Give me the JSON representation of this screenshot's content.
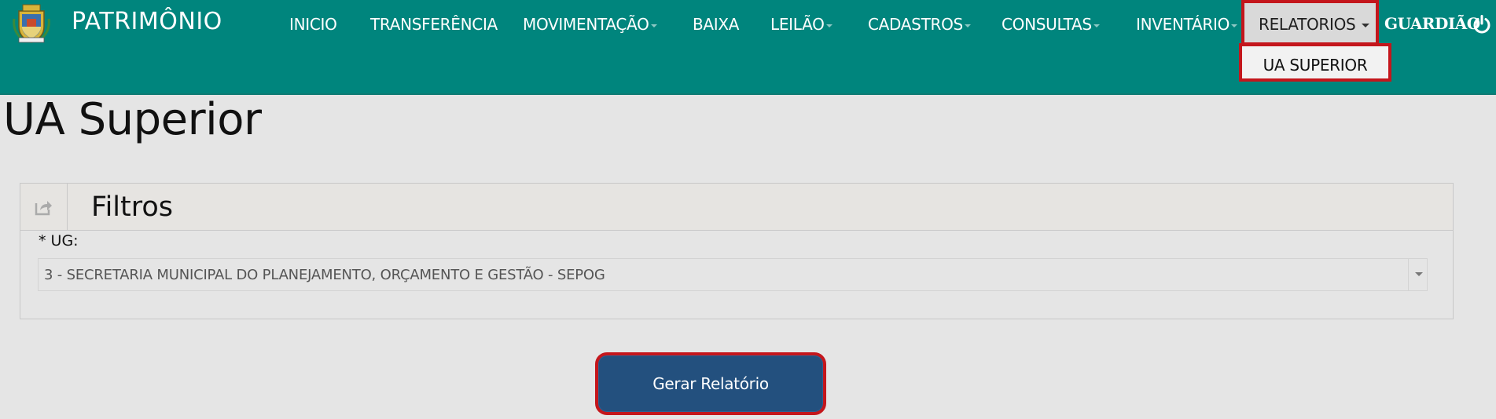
{
  "app": {
    "brand": "PATRIMÔNIO",
    "user": "GUARDIÃO"
  },
  "nav": {
    "items": [
      {
        "label": "INICIO",
        "has_dropdown": false
      },
      {
        "label": "TRANSFERÊNCIA",
        "has_dropdown": false
      },
      {
        "label": "MOVIMENTAÇÃO",
        "has_dropdown": true
      },
      {
        "label": "BAIXA",
        "has_dropdown": false
      },
      {
        "label": "LEILÃO",
        "has_dropdown": true
      },
      {
        "label": "CADASTROS",
        "has_dropdown": true
      },
      {
        "label": "CONSULTAS",
        "has_dropdown": true
      },
      {
        "label": "INVENTÁRIO",
        "has_dropdown": true
      }
    ],
    "active": {
      "label": "RELATORIOS"
    },
    "dropdown": [
      {
        "label": "UA SUPERIOR"
      }
    ]
  },
  "page": {
    "title": "UA Superior"
  },
  "filters": {
    "title": "Filtros",
    "ug_label": "* UG:",
    "ug_value": "3 - SECRETARIA MUNICIPAL DO PLANEJAMENTO, ORÇAMENTO E GESTÃO - SEPOG"
  },
  "actions": {
    "generate_label": "Gerar Relatório"
  },
  "colors": {
    "navbar": "#00857d",
    "highlight": "#c4161c",
    "button": "#23507e",
    "background": "#e5e5e5"
  }
}
